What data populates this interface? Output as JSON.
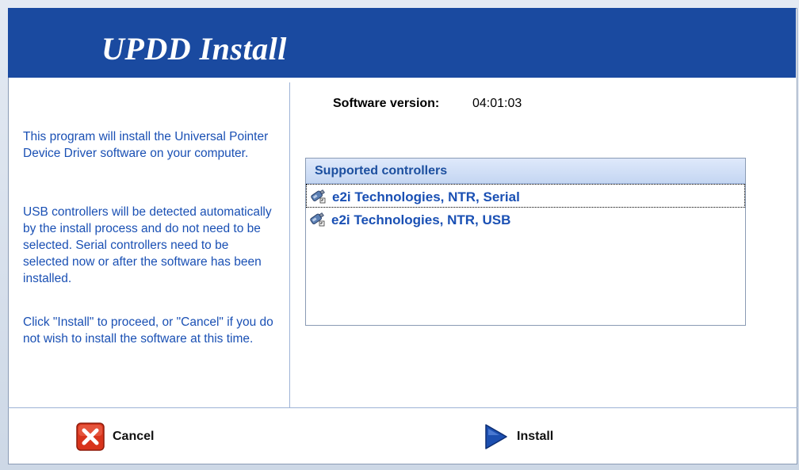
{
  "banner": {
    "title": "UPDD Install"
  },
  "description": {
    "paragraph1": "This program will install the Universal Pointer Device Driver software on your computer.",
    "paragraph2": "USB controllers will be detected automatically by the install process and do not need to be selected. Serial controllers need to be selected now or after the software has been installed.",
    "paragraph3": "Click \"Install\" to proceed, or \"Cancel\" if you do not wish to install the software at this time."
  },
  "version": {
    "label": "Software version:",
    "value": "04:01:03"
  },
  "controllers": {
    "header": "Supported controllers",
    "items": [
      {
        "label": "e2i Technologies, NTR, Serial",
        "icon": "controller-icon",
        "selected": true
      },
      {
        "label": "e2i Technologies, NTR, USB",
        "icon": "controller-icon",
        "selected": false
      }
    ]
  },
  "buttons": {
    "cancel": {
      "label": "Cancel",
      "icon": "cancel-x-icon",
      "color": "#d8341c"
    },
    "install": {
      "label": "Install",
      "icon": "play-arrow-icon",
      "color": "#1c4fb0"
    }
  }
}
